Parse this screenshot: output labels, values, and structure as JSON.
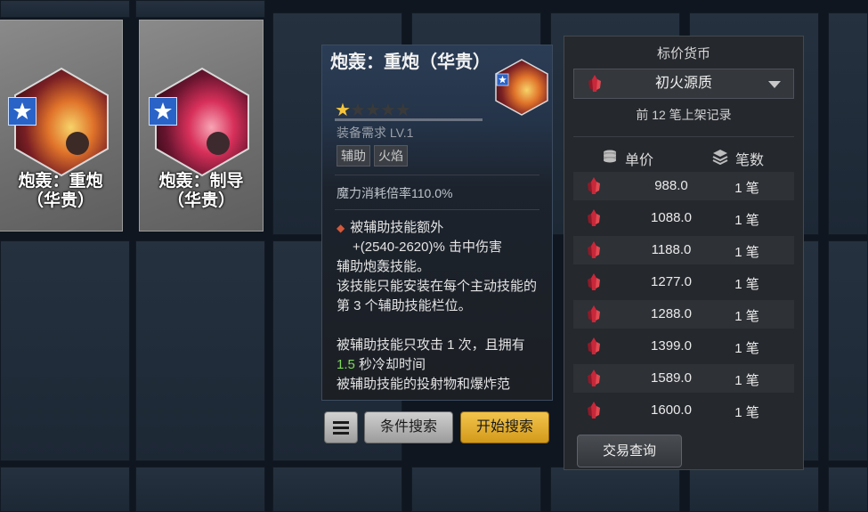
{
  "cards": [
    {
      "name_line1": "炮轰：重炮",
      "name_line2": "（华贵）"
    },
    {
      "name_line1": "炮轰：制导",
      "name_line2": "（华贵）"
    }
  ],
  "tooltip": {
    "title": "炮轰：重炮（华贵）",
    "rating": "1 of 5 stars",
    "requirement": "装备需求 LV.1",
    "tags": [
      "辅助",
      "火焰"
    ],
    "mana": "魔力消耗倍率110.0%",
    "bullet_line1": "被辅助技能额外",
    "bullet_line2": "+(2540-2620)% 击中伤害",
    "desc1": "辅助炮轰技能。",
    "desc2": "该技能只能安装在每个主动技能的第 3 个辅助技能栏位。",
    "desc3_a": "被辅助技能只攻击 1 次，且拥有 ",
    "desc3_green": "1.5",
    "desc3_b": " 秒冷却时间",
    "desc4": "被辅助技能的投射物和爆炸范"
  },
  "buttons": {
    "condition_search": "条件搜索",
    "start_search": "开始搜索",
    "trade_query": "交易查询"
  },
  "panel": {
    "title": "标价货币",
    "currency": "初火源质",
    "subtitle": "前 12 笔上架记录",
    "col_price": "单价",
    "col_count": "笔数",
    "rows": [
      {
        "price": "988.0",
        "count": "1 笔"
      },
      {
        "price": "1088.0",
        "count": "1 笔"
      },
      {
        "price": "1188.0",
        "count": "1 笔"
      },
      {
        "price": "1277.0",
        "count": "1 笔"
      },
      {
        "price": "1288.0",
        "count": "1 笔"
      },
      {
        "price": "1399.0",
        "count": "1 笔"
      },
      {
        "price": "1589.0",
        "count": "1 笔"
      },
      {
        "price": "1600.0",
        "count": "1 笔"
      }
    ]
  },
  "colors": {
    "accent_gold": "#f2c44c",
    "highlight_green": "#7ed957",
    "crystal_red": "#c8283a"
  },
  "icons": {
    "menu": "hamburger-icon",
    "coin": "coin-stack-icon",
    "layers": "layers-icon",
    "currency": "red-crystal-icon",
    "badge": "star-badge-icon"
  }
}
